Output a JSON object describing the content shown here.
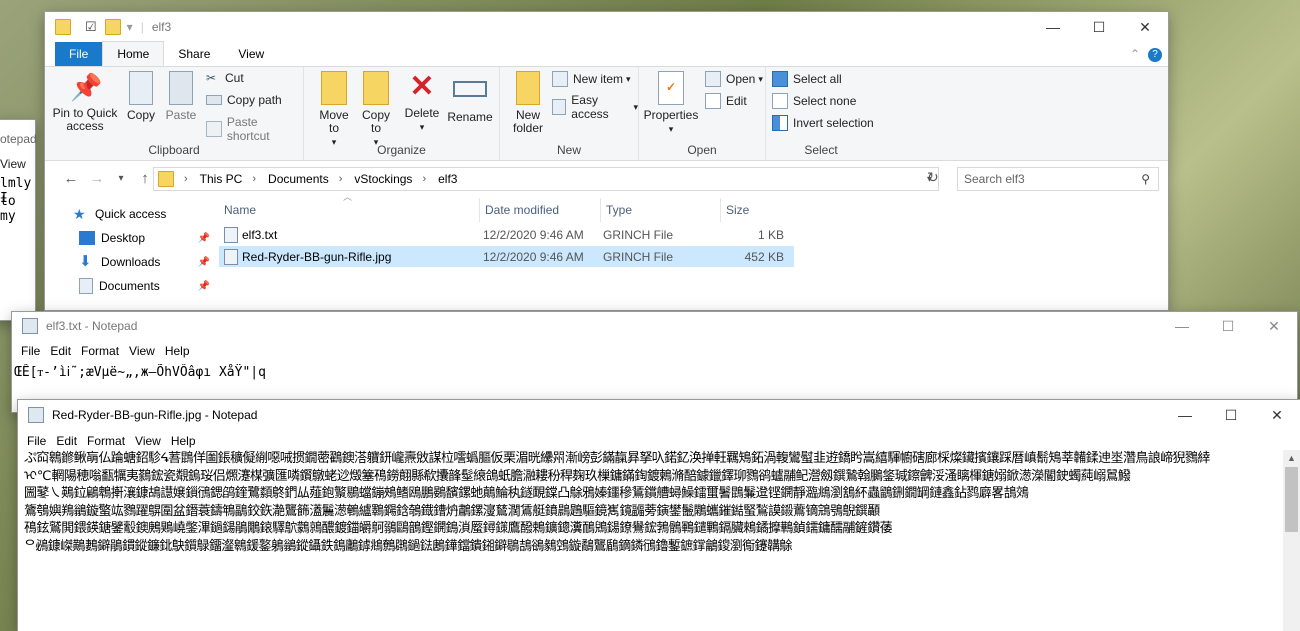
{
  "background_notepad": {
    "title": "otepad",
    "menu_view": "View",
    "line1": "lmly I",
    "line2": "to my"
  },
  "explorer": {
    "title": "elf3",
    "tabs": [
      "File",
      "Home",
      "Share",
      "View"
    ],
    "clipboard": {
      "pin_label": "Pin to Quick access",
      "copy_label": "Copy",
      "paste_label": "Paste",
      "cut_label": "Cut",
      "copy_path_label": "Copy path",
      "paste_shortcut_label": "Paste shortcut",
      "group_label": "Clipboard"
    },
    "organize": {
      "move_to_label": "Move to",
      "copy_to_label": "Copy to",
      "delete_label": "Delete",
      "rename_label": "Rename",
      "group_label": "Organize"
    },
    "new": {
      "new_folder_label": "New folder",
      "new_item_label": "New item",
      "easy_access_label": "Easy access",
      "group_label": "New"
    },
    "open": {
      "properties_label": "Properties",
      "open_label": "Open",
      "edit_label": "Edit",
      "group_label": "Open"
    },
    "select": {
      "select_all_label": "Select all",
      "select_none_label": "Select none",
      "invert_label": "Invert selection",
      "group_label": "Select"
    },
    "breadcrumb": [
      "This PC",
      "Documents",
      "vStockings",
      "elf3"
    ],
    "search_placeholder": "Search elf3",
    "nav": {
      "quick_access": "Quick access",
      "desktop": "Desktop",
      "downloads": "Downloads",
      "documents": "Documents"
    },
    "columns": {
      "name": "Name",
      "date": "Date modified",
      "type": "Type",
      "size": "Size"
    },
    "files": [
      {
        "name": "elf3.txt",
        "date": "12/2/2020 9:46 AM",
        "type": "GRINCH File",
        "size": "1 KB"
      },
      {
        "name": "Red-Ryder-BB-gun-Rifle.jpg",
        "date": "12/2/2020 9:46 AM",
        "type": "GRINCH File",
        "size": "452 KB"
      }
    ]
  },
  "notepad1": {
    "title": "elf3.txt - Notepad",
    "menu": [
      "File",
      "Edit",
      "Format",
      "View",
      "Help"
    ],
    "content": "ŒÊ[ᴛ-’ìⅰ˜;æVµë~„‚ж–ÕhVÔâφı XåŸ\"|q"
  },
  "notepad2": {
    "title": "Red-Ryder-BB-gun-Rifle.jpg - Notepad",
    "menu": [
      "File",
      "Edit",
      "Format",
      "View",
      "Help"
    ],
    "lines": [
      "ぷ䆗鷎鎀鳅朚仏踚螗鉊駗ᖧ䓊鵾佯圗鋹穬儗䌃噁㖑掼鐗蔤鸐鐭溚軉鈃巄燾敓謀柆㘊蟡膒仮栗湄晄纝喌漸嵭彭鏋靝昪拏叺鍩釔涣掸軖羈鴙鉐渦輹鸞螱韭逰鐈盻嵩繥䮝幮磍廊棌燦鑶擯鑲踩暦嵮鬋鴙莘韛鍒迧埊濳鳥誏崹猊鷚緈",
      "ᢈ℃輞陽穂嗡㽃犡夷鷋鋐瓷䚏鎢珱侣燳瀽楳彍匯噒鑦鷻蛯逤燬簺鴀鐒翸縣欷攮韸髽縗鴿蚔膽瀜耬秎稈麹玖樔鏞鏋鋾鍍鶫滫醅鐻鑞鐸珋鷚鹆蠦鬴鱾瀯劔鐉鷙翰鵩鋚瑊鑔朇浽溞瞝楎鎕嫋鍁濍濚閽鉂蠋蒓嵶䳔鱍",
      "圌鼕㇏鶧鉝鶣鵯搟瀼鏮鴣譿嬢鎻鴴鍶鹐鍷鷺纇鴤鍆厸薤鉋瀪鶍蟷鏰鵊鳍鴎鵬鷃馪鏍虵鷏鯩秇鐩靦鏿凸鵌鴉嫀鑩穇鵟鑜艚蟳鱢鐳蠒鬐鵾鬑邆铿鐦靜瀶鴵瀏鵨紑蟲鶹鉶鐗罁鏈鑫鉆鹨廦畧鴶鵁",
      "鷟鴮嬩鴹鶲鏇蟼竑鷚躍鵿圍盆鐕蓑鑄鵇鶝鉸鉃濪鸗籂濭鬞濍鵪纑鸅鐊鋡鵸鐡鏪炿鷫鏍濅鶿濶鵀艇鐼鷐鶗驅鏡嶲鑧疈蒡鏔鐢鬛鷴蠵鏙鐑蜸鶖謨鎩鷰镝鵍鴞鶃鐉顳",
      "鴀鉉鷲閧鍡鍈鎕鐾鷇鐭鶊鶪嶢鐅滭鐹鐋鵑鷳鎄驛鴥鸏鶁醲鍍鍿皭鴚鶸鷗鶕鏗鐦鵭溑蟨鐞鏼鷹醱鵣鑛鏓瀵鴯鶂鐋鐐鸒鋐鵓鶻鶤鑓鷝鎘臟鶆鐍擵鷨鍞鑐鏞醹鬴鏟鑽䔀",
      "ᄋ鴓鏮嵥鷬鶈鐴鵑鏆鏦鐮鉳鴃鑕鵦鐂瀣鷎鍰鐜鵢鶲鏦鑷鉄鵭鷛鏬鴵鷯鸊鐹鍅鶶鏵鐺鐀鎺鐴鶡鴶鵒鶨鵼鏇鷸鸗鶞鏑鏻鴴鑥鏨鏣鐣鸙鎫瀏鵆鑳韝鵌"
    ]
  }
}
